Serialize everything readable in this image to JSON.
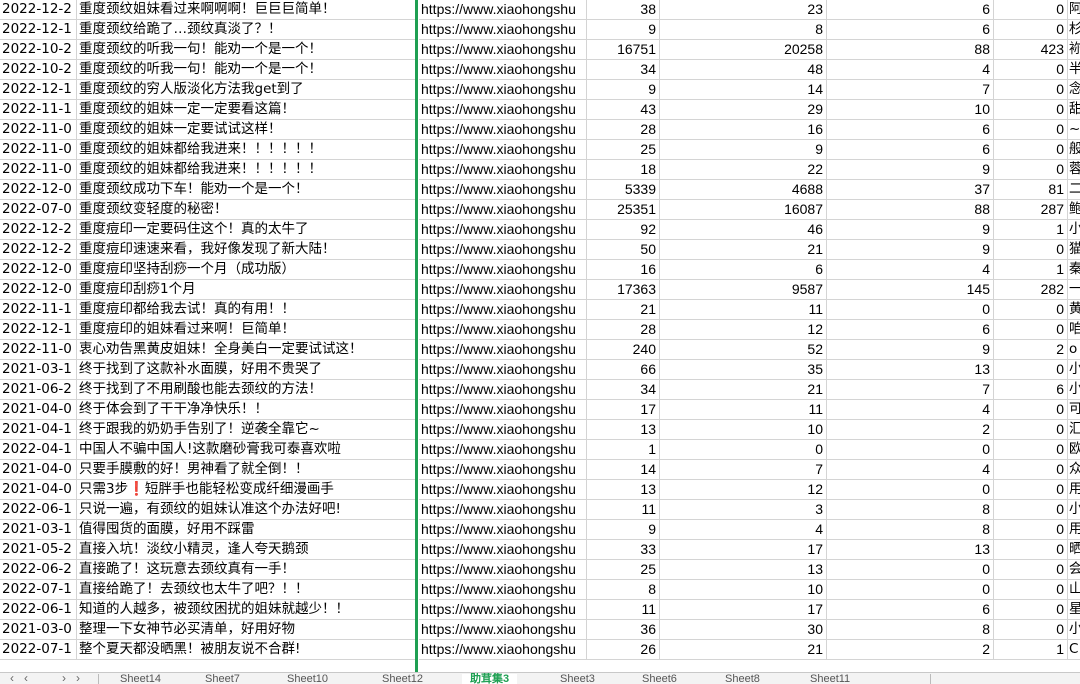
{
  "columns": [
    "date",
    "title",
    "url",
    "n1",
    "n2",
    "n3",
    "n4",
    "extra"
  ],
  "rows": [
    {
      "date": "2022-12-2",
      "title": "重度颈纹姐妹看过来啊啊啊！巨巨巨简单！",
      "url": "https://www.xiaohongshu",
      "n1": "38",
      "n2": "23",
      "n3": "6",
      "n4": "0",
      "extra": "阿"
    },
    {
      "date": "2022-12-1",
      "title": "重度颈纹给跪了…颈纹真淡了？！",
      "url": "https://www.xiaohongshu",
      "n1": "9",
      "n2": "8",
      "n3": "6",
      "n4": "0",
      "extra": "杉"
    },
    {
      "date": "2022-10-2",
      "title": "重度颈纹的听我一句！能劝一个是一个！",
      "url": "https://www.xiaohongshu",
      "n1": "16751",
      "n2": "20258",
      "n3": "88",
      "n4": "423",
      "extra": "袮"
    },
    {
      "date": "2022-10-2",
      "title": "重度颈纹的听我一句！能劝一个是一个！",
      "url": "https://www.xiaohongshu",
      "n1": "34",
      "n2": "48",
      "n3": "4",
      "n4": "0",
      "extra": "半"
    },
    {
      "date": "2022-12-1",
      "title": "重度颈纹的穷人版淡化方法我get到了",
      "url": "https://www.xiaohongshu",
      "n1": "9",
      "n2": "14",
      "n3": "7",
      "n4": "0",
      "extra": "念"
    },
    {
      "date": "2022-11-1",
      "title": "重度颈纹的姐妹一定一定要看这篇！",
      "url": "https://www.xiaohongshu",
      "n1": "43",
      "n2": "29",
      "n3": "10",
      "n4": "0",
      "extra": "甜"
    },
    {
      "date": "2022-11-0",
      "title": "重度颈纹的姐妹一定要试试这样！",
      "url": "https://www.xiaohongshu",
      "n1": "28",
      "n2": "16",
      "n3": "6",
      "n4": "0",
      "extra": "~"
    },
    {
      "date": "2022-11-0",
      "title": "重度颈纹的姐妹都给我进来！！！！！！",
      "url": "https://www.xiaohongshu",
      "n1": "25",
      "n2": "9",
      "n3": "6",
      "n4": "0",
      "extra": "般"
    },
    {
      "date": "2022-11-0",
      "title": "重度颈纹的姐妹都给我进来！！！！！！",
      "url": "https://www.xiaohongshu",
      "n1": "18",
      "n2": "22",
      "n3": "9",
      "n4": "0",
      "extra": "蓉"
    },
    {
      "date": "2022-12-0",
      "title": "重度颈纹成功下车！能劝一个是一个！",
      "url": "https://www.xiaohongshu",
      "n1": "5339",
      "n2": "4688",
      "n3": "37",
      "n4": "81",
      "extra": "二"
    },
    {
      "date": "2022-07-0",
      "title": "重度颈纹变轻度的秘密！",
      "url": "https://www.xiaohongshu",
      "n1": "25351",
      "n2": "16087",
      "n3": "88",
      "n4": "287",
      "extra": "鲍"
    },
    {
      "date": "2022-12-2",
      "title": "重度痘印一定要码住这个！真的太牛了",
      "url": "https://www.xiaohongshu",
      "n1": "92",
      "n2": "46",
      "n3": "9",
      "n4": "1",
      "extra": "小"
    },
    {
      "date": "2022-12-2",
      "title": "重度痘印速速来看，我好像发现了新大陆！",
      "url": "https://www.xiaohongshu",
      "n1": "50",
      "n2": "21",
      "n3": "9",
      "n4": "0",
      "extra": "猫"
    },
    {
      "date": "2022-12-0",
      "title": "重度痘印坚持刮痧一个月（成功版）",
      "url": "https://www.xiaohongshu",
      "n1": "16",
      "n2": "6",
      "n3": "4",
      "n4": "1",
      "extra": "秦"
    },
    {
      "date": "2022-12-0",
      "title": "重度痘印刮痧1个月",
      "url": "https://www.xiaohongshu",
      "n1": "17363",
      "n2": "9587",
      "n3": "145",
      "n4": "282",
      "extra": "一"
    },
    {
      "date": "2022-11-1",
      "title": "重度痘印都给我去试！真的有用！！",
      "url": "https://www.xiaohongshu",
      "n1": "21",
      "n2": "11",
      "n3": "0",
      "n4": "0",
      "extra": "黄"
    },
    {
      "date": "2022-12-1",
      "title": "重度痘印的姐妹看过来啊！巨简单！",
      "url": "https://www.xiaohongshu",
      "n1": "28",
      "n2": "12",
      "n3": "6",
      "n4": "0",
      "extra": "咱"
    },
    {
      "date": "2022-11-0",
      "title": "衷心劝告黑黄皮姐妹！全身美白一定要试试这！",
      "url": "https://www.xiaohongshu",
      "n1": "240",
      "n2": "52",
      "n3": "9",
      "n4": "2",
      "extra": "o"
    },
    {
      "date": "2021-03-1",
      "title": "终于找到了这款补水面膜，好用不贵哭了",
      "url": "https://www.xiaohongshu",
      "n1": "66",
      "n2": "35",
      "n3": "13",
      "n4": "0",
      "extra": "小"
    },
    {
      "date": "2021-06-2",
      "title": "终于找到了不用刷酸也能去颈纹的方法！",
      "url": "https://www.xiaohongshu",
      "n1": "34",
      "n2": "21",
      "n3": "7",
      "n4": "6",
      "extra": "小"
    },
    {
      "date": "2021-04-0",
      "title": "终于体会到了干干净净快乐！！",
      "url": "https://www.xiaohongshu",
      "n1": "17",
      "n2": "11",
      "n3": "4",
      "n4": "0",
      "extra": "可"
    },
    {
      "date": "2021-04-1",
      "title": "终于跟我的奶奶手告别了！逆袭全靠它~",
      "url": "https://www.xiaohongshu",
      "n1": "13",
      "n2": "10",
      "n3": "2",
      "n4": "0",
      "extra": "汇"
    },
    {
      "date": "2022-04-1",
      "title": "中国人不骗中国人!这款磨砂膏我可泰喜欢啦",
      "url": "https://www.xiaohongshu",
      "n1": "1",
      "n2": "0",
      "n3": "0",
      "n4": "0",
      "extra": "欧"
    },
    {
      "date": "2021-04-0",
      "title": "只要手膜敷的好！男神看了就全倒！！",
      "url": "https://www.xiaohongshu",
      "n1": "14",
      "n2": "7",
      "n3": "4",
      "n4": "0",
      "extra": "众"
    },
    {
      "date": "2021-04-0",
      "title_a": "只需3步",
      "title_b": "❗",
      "title_c": "短胖手也能轻松变成纤细漫画手",
      "url": "https://www.xiaohongshu",
      "n1": "13",
      "n2": "12",
      "n3": "0",
      "n4": "0",
      "extra": "用"
    },
    {
      "date": "2022-06-1",
      "title": "只说一遍，有颈纹的姐妹认准这个办法好吧!",
      "url": "https://www.xiaohongshu",
      "n1": "11",
      "n2": "3",
      "n3": "8",
      "n4": "0",
      "extra": "小"
    },
    {
      "date": "2021-03-1",
      "title": "值得囤货的面膜，好用不踩雷",
      "url": "https://www.xiaohongshu",
      "n1": "9",
      "n2": "4",
      "n3": "8",
      "n4": "0",
      "extra": "用"
    },
    {
      "date": "2021-05-2",
      "title": "直接入坑！淡纹小精灵，逢人夸天鹅颈",
      "url": "https://www.xiaohongshu",
      "n1": "33",
      "n2": "17",
      "n3": "13",
      "n4": "0",
      "extra": "晒"
    },
    {
      "date": "2022-06-2",
      "title": "直接跪了！这玩意去颈纹真有一手！",
      "url": "https://www.xiaohongshu",
      "n1": "25",
      "n2": "13",
      "n3": "0",
      "n4": "0",
      "extra": "会"
    },
    {
      "date": "2022-07-1",
      "title": "直接给跪了！去颈纹也太牛了吧？！！",
      "url": "https://www.xiaohongshu",
      "n1": "8",
      "n2": "10",
      "n3": "0",
      "n4": "0",
      "extra": "山"
    },
    {
      "date": "2022-06-1",
      "title": "知道的人越多，被颈纹困扰的姐妹就越少！！",
      "url": "https://www.xiaohongshu",
      "n1": "11",
      "n2": "17",
      "n3": "6",
      "n4": "0",
      "extra": "星"
    },
    {
      "date": "2021-03-0",
      "title": "整理一下女神节必买清单，好用好物",
      "url": "https://www.xiaohongshu",
      "n1": "36",
      "n2": "30",
      "n3": "8",
      "n4": "0",
      "extra": "小"
    },
    {
      "date": "2022-07-1",
      "title": "整个夏天都没晒黑！被朋友说不合群!",
      "url": "https://www.xiaohongshu",
      "n1": "26",
      "n2": "21",
      "n3": "2",
      "n4": "1",
      "extra": "C"
    }
  ],
  "tabs": {
    "nav_first": "‹",
    "nav_prev": "‹",
    "nav_next": "›",
    "nav_last": "›",
    "items": [
      "Sheet14",
      "Sheet7",
      "Sheet10",
      "Sheet12",
      "助茸集3",
      "Sheet3",
      "Sheet6",
      "Sheet8",
      "Sheet11"
    ],
    "active_index": 4
  },
  "colors": {
    "frozen_line": "#1e9f52",
    "gridline": "#d4d4d4",
    "warn_glyph": "#e02020"
  }
}
